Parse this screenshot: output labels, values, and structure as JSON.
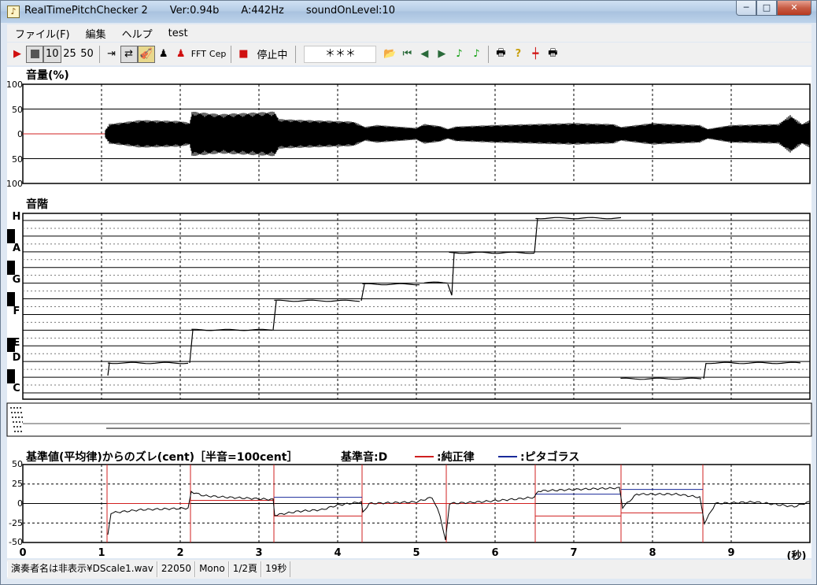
{
  "window": {
    "app_name": "RealTimePitchChecker 2",
    "version": "Ver:0.94b",
    "a_freq": "A:442Hz",
    "sound_on_level": "soundOnLevel:10",
    "min_symbol": "─",
    "max_symbol": "□",
    "close_symbol": "✕"
  },
  "menu": [
    "ファイル(F)",
    "編集",
    "ヘルプ",
    "test"
  ],
  "toolbar": {
    "play_icon": "play-icon",
    "stop_icon": "stop-icon",
    "speed_10": "10",
    "speed_25": "25",
    "speed_50": "50",
    "fft_label": "FFT",
    "cep_label": "Cep",
    "status": "停止中",
    "display": "＊＊＊"
  },
  "volume_panel": {
    "title": "音量(%)",
    "y_ticks": [
      "100",
      "50",
      "0",
      "50",
      "100"
    ]
  },
  "pitch_panel": {
    "title": "音階",
    "notes": [
      "H",
      "A",
      "G",
      "F",
      "E",
      "D",
      "C"
    ]
  },
  "cent_panel": {
    "title": "基準値(平均律)からのズレ(cent)［半音=100cent］",
    "base_note": "基準音:D",
    "legend_just": ":純正律",
    "legend_pyth": ":ピタゴラス",
    "y_ticks": [
      "50",
      "25",
      "0",
      "-25",
      "-50"
    ],
    "colors": {
      "just": "#d02020",
      "pythagorean": "#1a2a9a"
    }
  },
  "x_axis": {
    "ticks": [
      "0",
      "1",
      "2",
      "3",
      "4",
      "5",
      "6",
      "7",
      "8",
      "9"
    ],
    "unit": "(秒)"
  },
  "statusbar": [
    "演奏者名は非表示¥DScale1.wav",
    "22050",
    "Mono",
    "1/2頁",
    "19秒"
  ]
}
